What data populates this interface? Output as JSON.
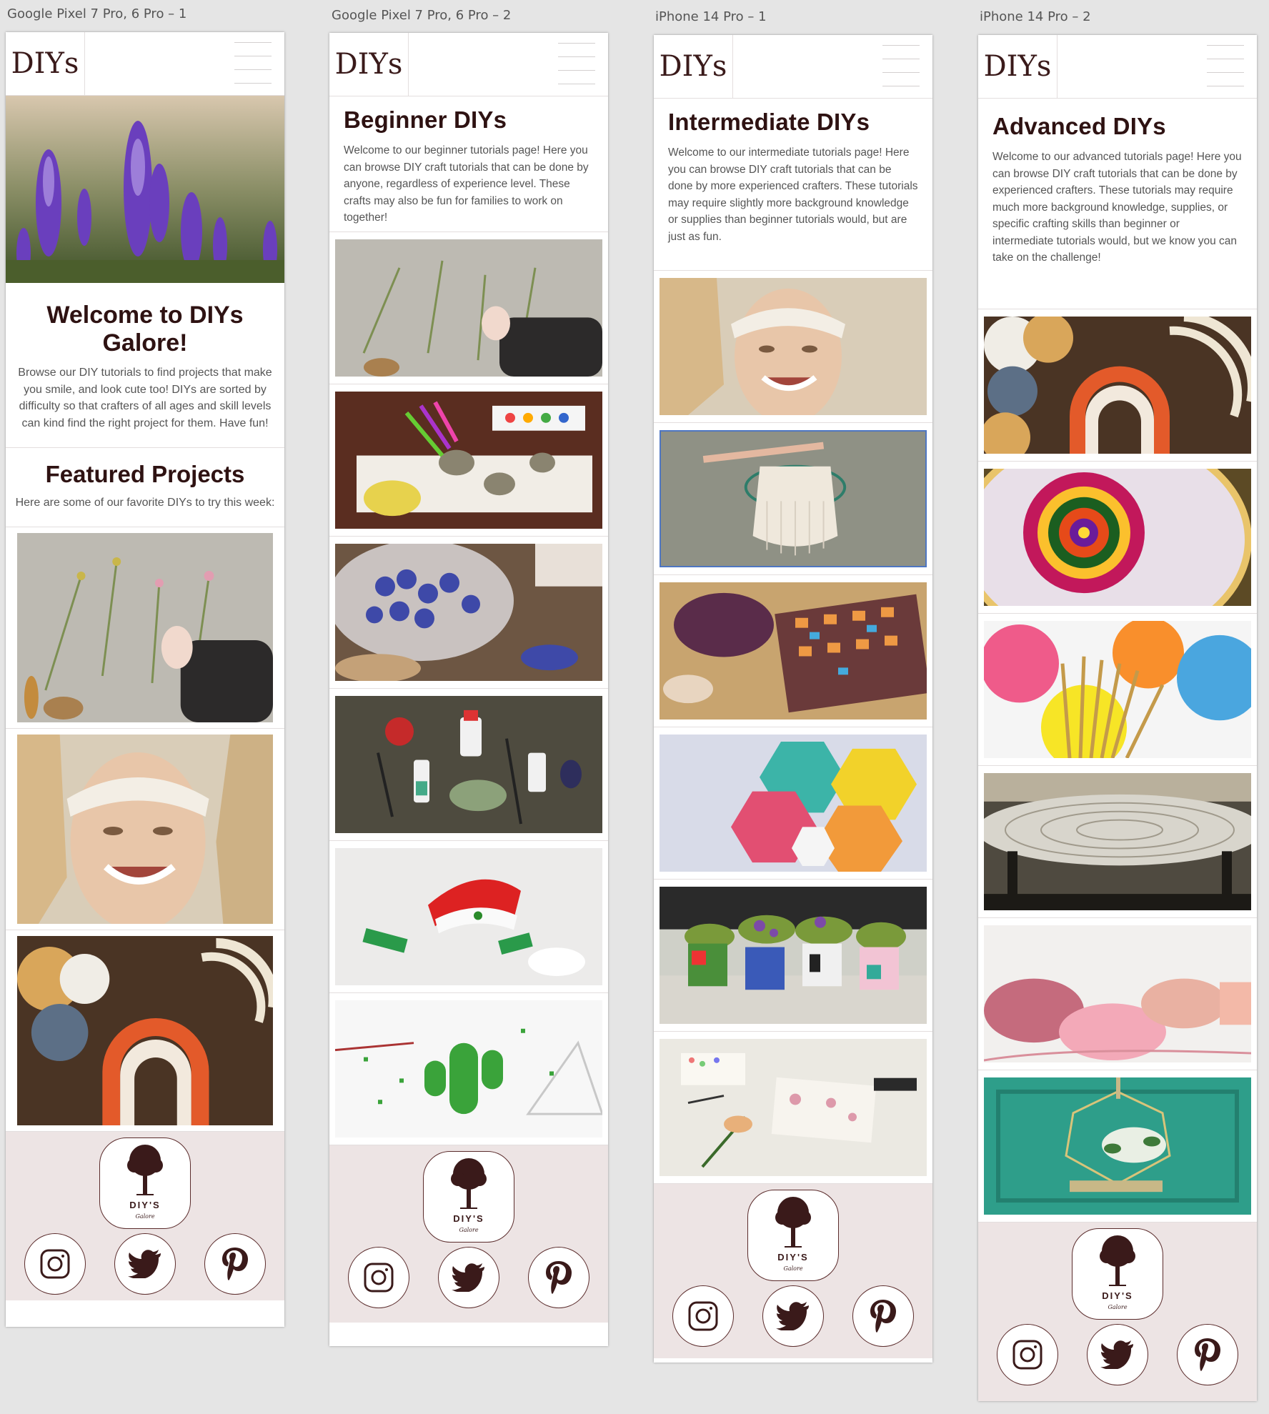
{
  "boards": [
    {
      "label": "Google Pixel 7 Pro, 6 Pro – 1"
    },
    {
      "label": "Google Pixel 7 Pro, 6 Pro – 2"
    },
    {
      "label": "iPhone 14 Pro – 1"
    },
    {
      "label": "iPhone 14 Pro – 2"
    }
  ],
  "logo_text": "DIYs",
  "home": {
    "welcome_title": "Welcome to DIYs Galore!",
    "welcome_text": "Browse our DIY tutorials to find projects that make you smile, and look cute too! DIYs are sorted by difficulty so that crafters of all ages and skill levels can kind find the right project for them. Have fun!",
    "featured_title": "Featured Projects",
    "featured_text": "Here are some of our favorite DIYs to try this week:"
  },
  "beginner": {
    "title": "Beginner DIYs",
    "text": "Welcome to our beginner tutorials page! Here you can browse DIY craft tutorials that can be done by anyone, regardless of experience level. These crafts may also be fun for families to work on together!"
  },
  "intermediate": {
    "title": "Intermediate DIYs",
    "text": "Welcome to our intermediate tutorials page! Here you can browse DIY craft tutorials that can be done by more experienced crafters. These tutorials may require slightly more background knowledge or supplies than beginner tutorials would, but are just as fun."
  },
  "advanced": {
    "title": "Advanced DIYs",
    "text": "Welcome to our advanced tutorials page! Here you can browse DIY craft tutorials that can be done by experienced crafters. These tutorials may require much more background knowledge, supplies, or specific crafting skills than beginner or intermediate tutorials would, but we know you can take on the challenge!"
  },
  "footer": {
    "brand": "DIY'S",
    "brand_sub": "Galore",
    "icons": [
      "instagram-icon",
      "twitter-icon",
      "pinterest-icon"
    ]
  },
  "colors": {
    "brand_dark": "#2e1212",
    "footer_bg": "#ede4e4",
    "icon": "#3a1a1a"
  }
}
